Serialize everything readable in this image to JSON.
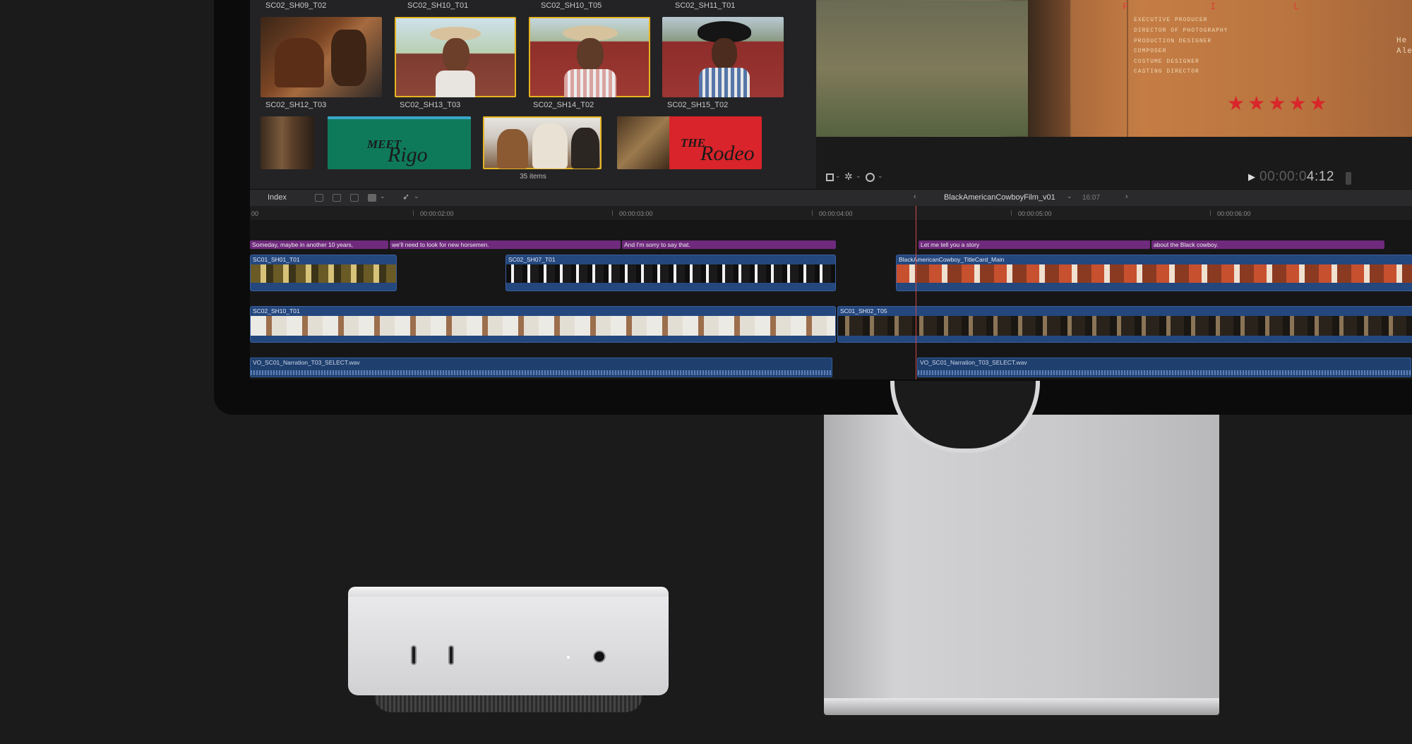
{
  "browser": {
    "row1_labels": [
      "SC02_SH09_T02",
      "SC02_SH10_T01",
      "SC02_SH10_T05",
      "SC02_SH11_T01"
    ],
    "row2_labels": [
      "SC02_SH12_T03",
      "SC02_SH13_T03",
      "SC02_SH14_T02",
      "SC02_SH15_T02"
    ],
    "row3_titles": {
      "meet_small": "MEET",
      "meet_big": "Rigo",
      "rodeo_small": "THE",
      "rodeo_big": "Rodeo"
    },
    "items_count": "35 items"
  },
  "viewer": {
    "title_letters": [
      "F",
      "I",
      "L"
    ],
    "credits": [
      "EXECUTIVE PRODUCER",
      "DIRECTOR OF PHOTOGRAPHY",
      "PRODUCTION DESIGNER",
      "COMPOSER",
      "COSTUME DESIGNER",
      "CASTING DIRECTOR"
    ],
    "credit_names": [
      "He",
      "Alej"
    ],
    "stars": 5,
    "timecode_dim": "00:00:0",
    "timecode_bright": "4:12"
  },
  "timeline_toolbar": {
    "index_label": "Index",
    "project_name": "BlackAmericanCowboyFilm_v01",
    "duration": "16:07"
  },
  "ruler": {
    "labels": [
      "00",
      "00:00:02:00",
      "00:00:03:00",
      "00:00:04:00",
      "00:00:05:00",
      "00:00:06:00"
    ]
  },
  "timeline": {
    "captions": [
      "Someday, maybe in another 10 years,",
      "we'll need to look for new horsemen.",
      "And I'm sorry to say that.",
      "Let me tell you a story",
      "about the Black cowboy."
    ],
    "clips": [
      "SC01_SH01_T01",
      "SC02_SH07_T01",
      "BlackAmericanCowboy_TitleCard_Main",
      "SC02_SH10_T01",
      "SC01_SH02_T05"
    ],
    "audio": [
      "VO_SC01_Narration_T03_SELECT.wav",
      "VO_SC01_Narration_T03_SELECT.wav"
    ]
  },
  "colors": {
    "caption": "#6f2a7d",
    "clip": "#24477e",
    "stars": "#d8262a",
    "selection": "#e6b422"
  }
}
